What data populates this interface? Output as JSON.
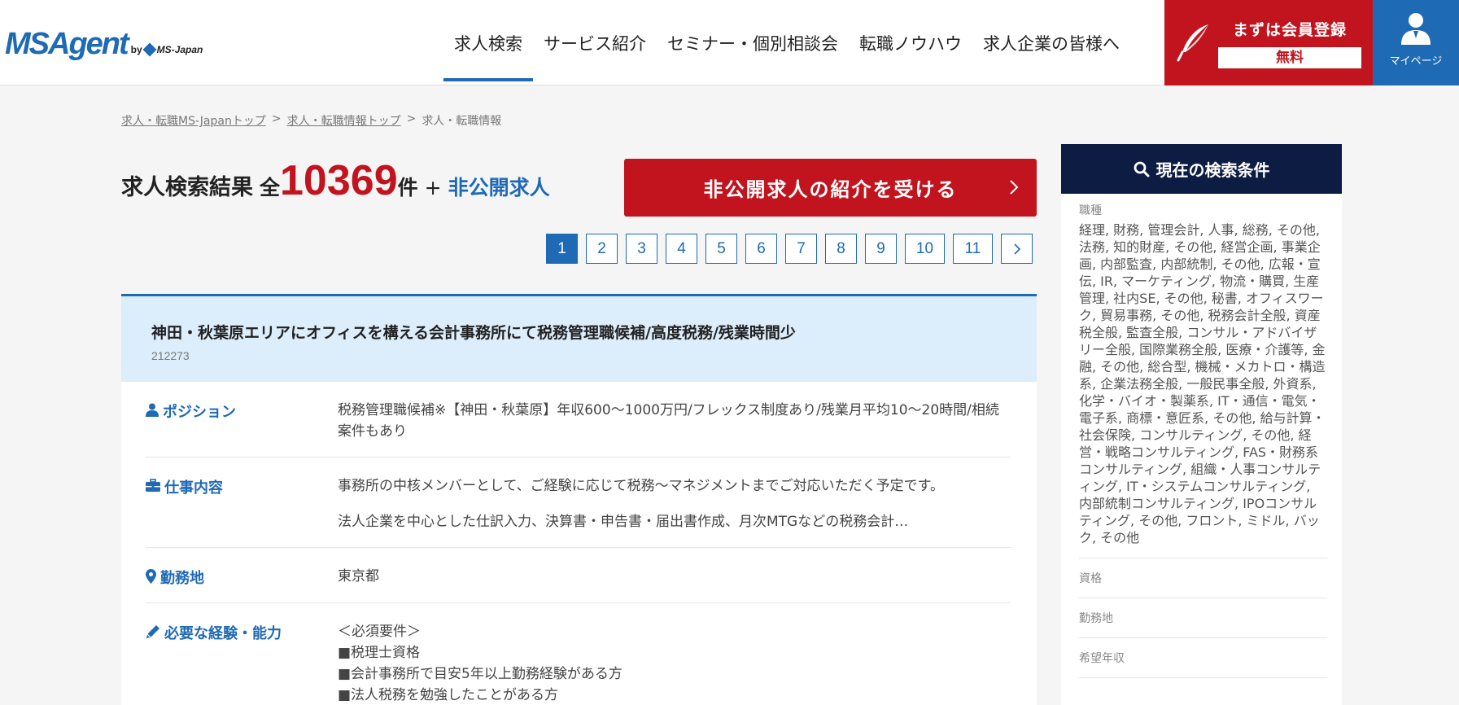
{
  "header": {
    "logo_main": "MSAgent",
    "logo_by": "by",
    "logo_company": "MS-Japan",
    "nav": [
      {
        "label": "求人検索"
      },
      {
        "label": "サービス紹介"
      },
      {
        "label": "セミナー・個別相談会"
      },
      {
        "label": "転職ノウハウ"
      },
      {
        "label": "求人企業の皆様へ"
      }
    ],
    "register_label": "まずは会員登録",
    "register_free": "無料",
    "mypage_label": "マイページ"
  },
  "breadcrumb": {
    "items": [
      "求人・転職MS-Japanトップ",
      "求人・転職情報トップ"
    ],
    "separator": ">",
    "current": "求人・転職情報"
  },
  "result": {
    "title": "求人検索結果",
    "prefix": "全",
    "count": "10369",
    "suffix": "件",
    "plus": "+",
    "hidden_jobs_link": "非公開求人",
    "cta_label": "非公開求人の紹介を受ける"
  },
  "pagination": {
    "pages": [
      "1",
      "2",
      "3",
      "4",
      "5",
      "6",
      "7",
      "8",
      "9",
      "10",
      "11"
    ],
    "current": "1"
  },
  "job": {
    "title": "神田・秋葉原エリアにオフィスを構える会計事務所にて税務管理職候補/高度税務/残業時間少",
    "id": "212273",
    "position_label": "ポジション",
    "position_value": "税務管理職候補※【神田・秋葉原】年収600〜1000万円/フレックス制度あり/残業月平均10〜20時間/相続案件もあり",
    "work_label": "仕事内容",
    "work_value_1": "事務所の中核メンバーとして、ご経験に応じて税務〜マネジメントまでご対応いただく予定です。",
    "work_value_2": "法人企業を中心とした仕訳入力、決算書・申告書・届出書作成、月次MTGなどの税務会計…",
    "location_label": "勤務地",
    "location_value": "東京都",
    "requirements_label": "必要な経験・能力",
    "requirements": [
      "＜必須要件＞",
      "■税理士資格",
      "■会計事務所で目安5年以上勤務経験がある方",
      "■法人税務を勉強したことがある方"
    ]
  },
  "sidebar": {
    "title": "現在の検索条件",
    "job_type_label": "職種",
    "job_type_value": "経理, 財務, 管理会計, 人事, 総務, その他, 法務, 知的財産, その他, 経営企画, 事業企画, 内部監査, 内部統制, その他, 広報・宣伝, IR, マーケティング, 物流・購買, 生産管理, 社内SE, その他, 秘書, オフィスワーク, 貿易事務, その他, 税務会計全般, 資産税全般, 監査全般, コンサル・アドバイザリー全般, 国際業務全般, 医療・介護等, 金融, その他, 総合型, 機械・メカトロ・構造系, 企業法務全般, 一般民事全般, 外資系, 化学・バイオ・製薬系, IT・通信・電気・電子系, 商標・意匠系, その他, 給与計算・社会保険, コンサルティング, その他, 経営・戦略コンサルティング, FAS・財務系コンサルティング, 組織・人事コンサルティング, IT・システムコンサルティング, 内部統制コンサルティング, IPOコンサルティング, その他, フロント, ミドル, バック, その他",
    "qualification_label": "資格",
    "location_label": "勤務地",
    "salary_label": "希望年収"
  },
  "colors": {
    "brand_blue": "#1f6ab5",
    "brand_red": "#c1141e",
    "navy": "#0d1c42",
    "card_head_bg": "#dcedfb"
  }
}
